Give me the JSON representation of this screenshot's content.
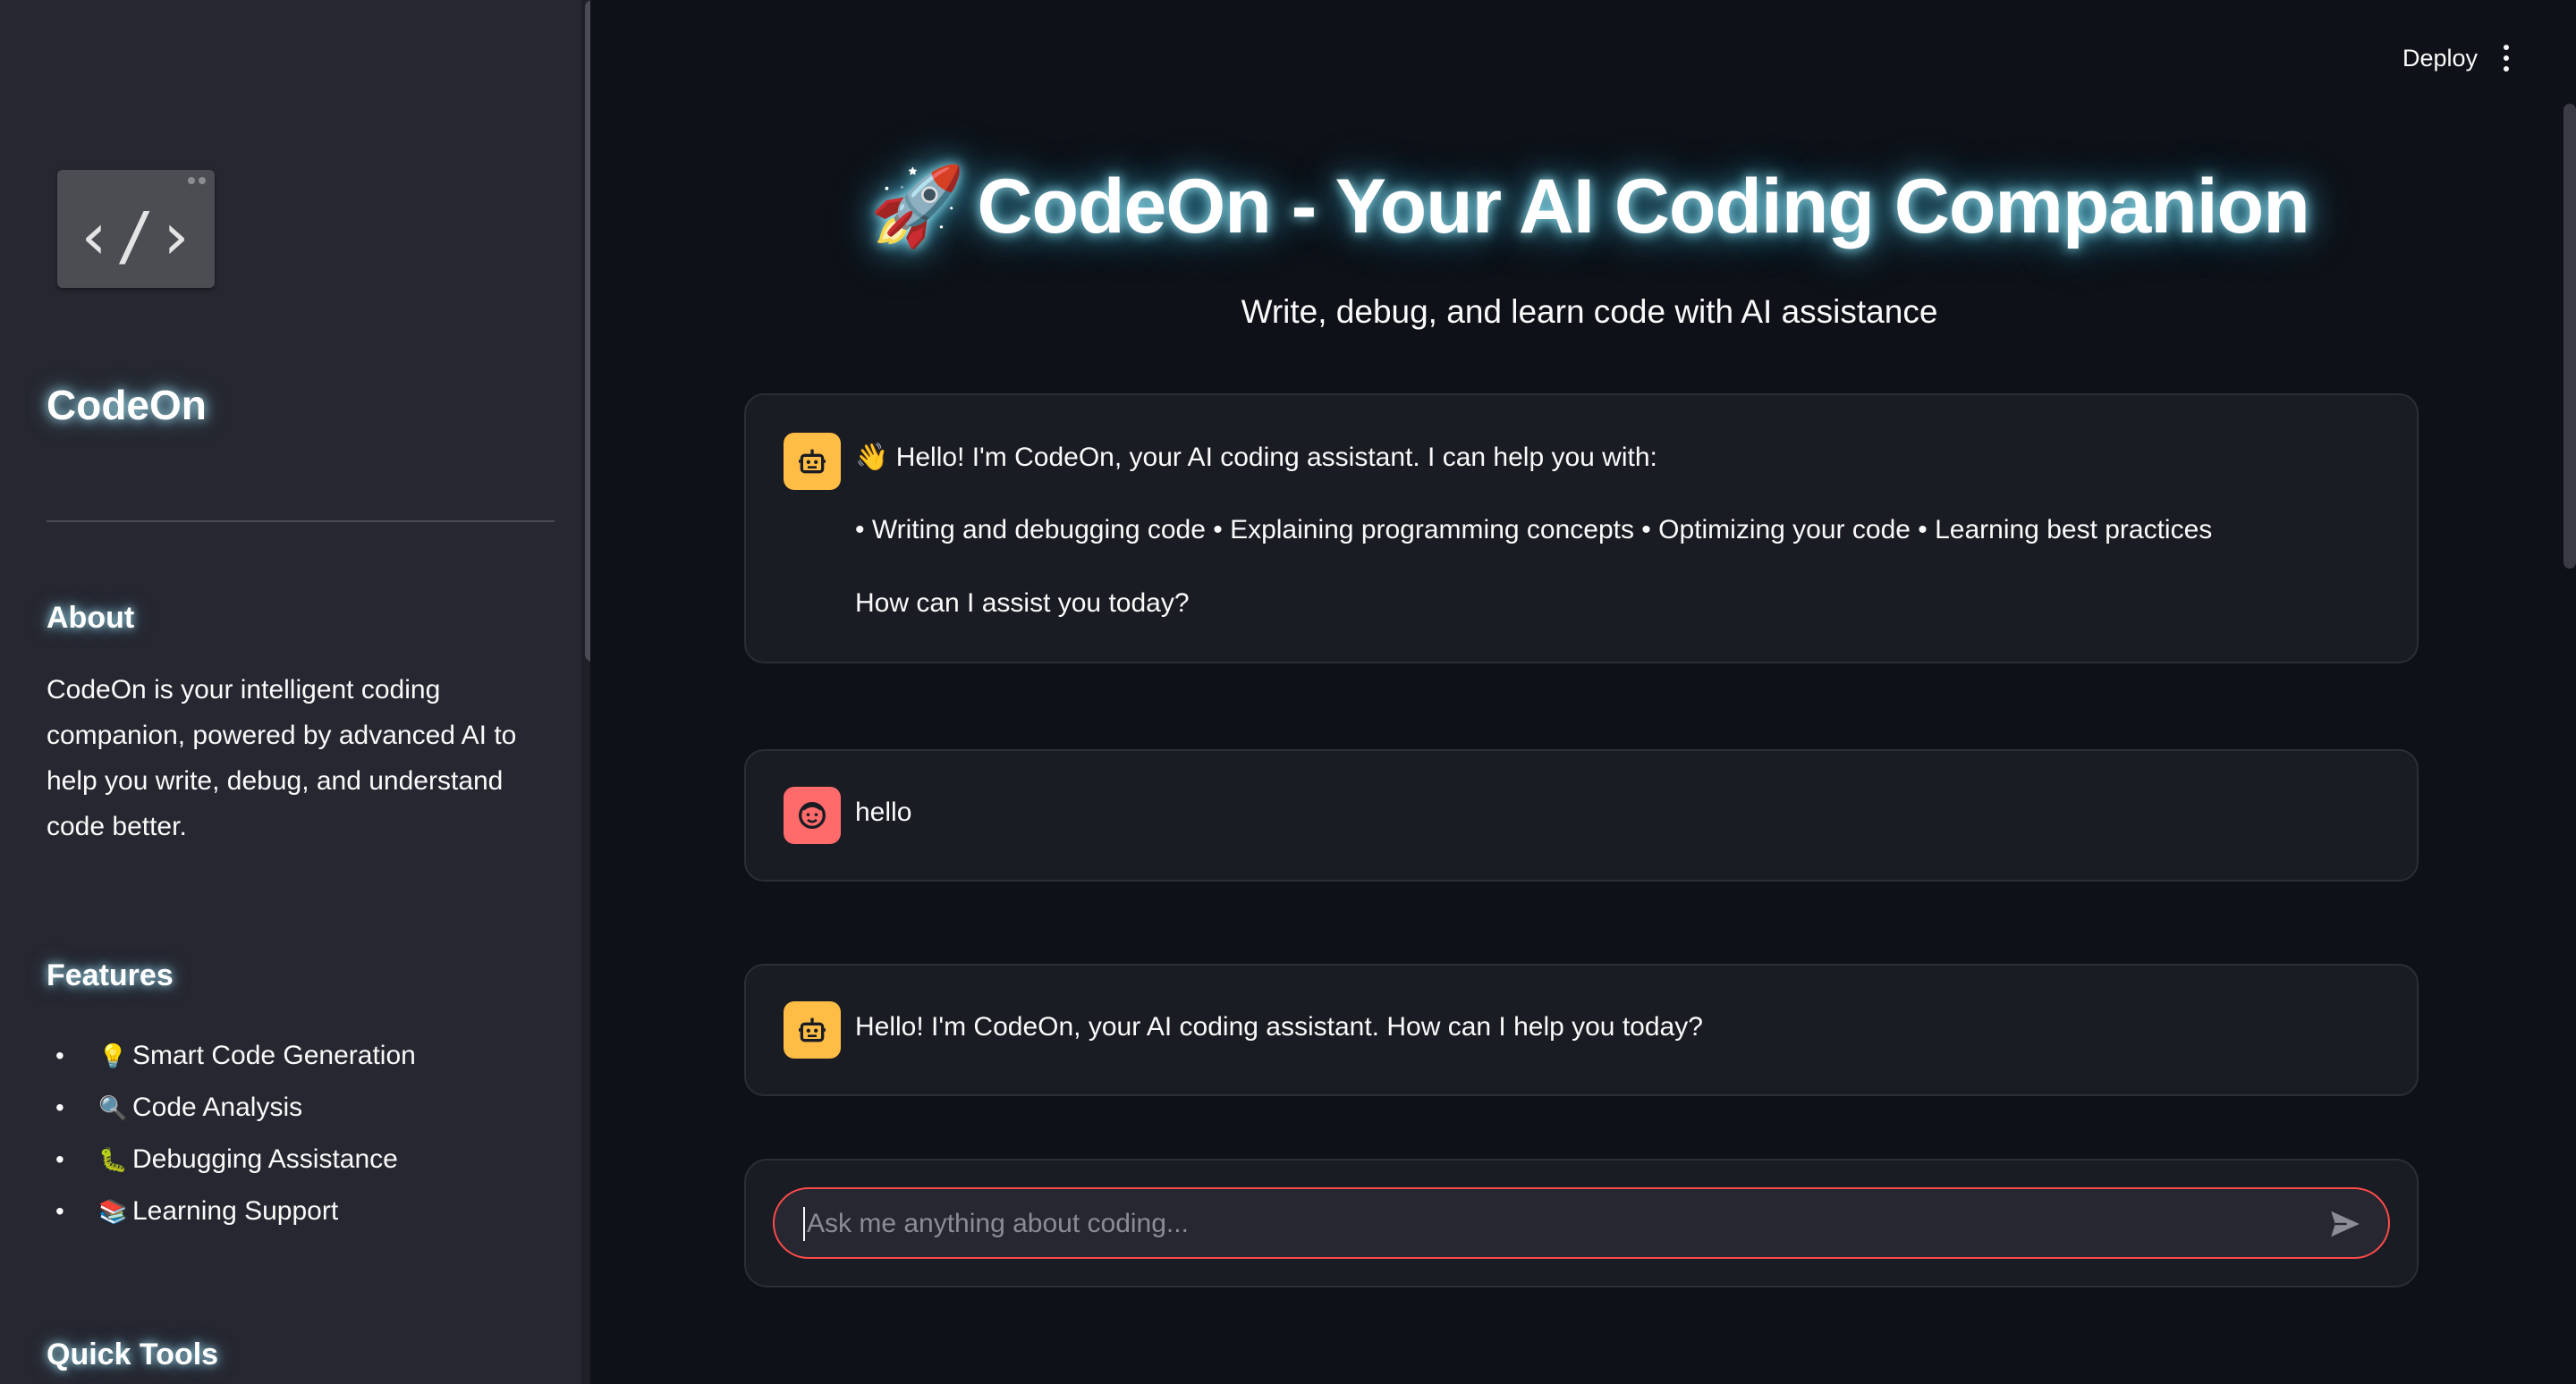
{
  "app": {
    "title": "CodeOn - Your AI Coding Companion",
    "title_emoji": "🚀",
    "subtitle": "Write, debug, and learn code with AI assistance"
  },
  "topbar": {
    "deploy_label": "Deploy",
    "menu_icon": "kebab-menu-icon"
  },
  "sidebar": {
    "logo_glyph": "‹/›",
    "title": "CodeOn",
    "about_heading": "About",
    "about_text": "CodeOn is your intelligent coding companion, powered by advanced AI to help you write, debug, and understand code better.",
    "features_heading": "Features",
    "features": [
      {
        "emoji": "💡",
        "label": "Smart Code Generation"
      },
      {
        "emoji": "🔍",
        "label": "Code Analysis"
      },
      {
        "emoji": "🐛",
        "label": "Debugging Assistance"
      },
      {
        "emoji": "📚",
        "label": "Learning Support"
      }
    ],
    "quick_tools_heading": "Quick Tools"
  },
  "messages": [
    {
      "role": "assistant",
      "lines": [
        "👋 Hello! I'm CodeOn, your AI coding assistant. I can help you with:",
        "• Writing and debugging code • Explaining programming concepts • Optimizing your code • Learning best practices",
        "How can I assist you today?"
      ]
    },
    {
      "role": "user",
      "text": "hello"
    },
    {
      "role": "assistant",
      "text": "Hello! I'm CodeOn, your AI coding assistant. How can I help you today?"
    }
  ],
  "chat_input": {
    "placeholder": "Ask me anything about coding...",
    "value": ""
  },
  "colors": {
    "background": "#0e1117",
    "sidebar": "#262730",
    "bot_avatar": "#ffbd45",
    "user_avatar": "#ff6b6b",
    "input_border": "#ff4b4b"
  }
}
